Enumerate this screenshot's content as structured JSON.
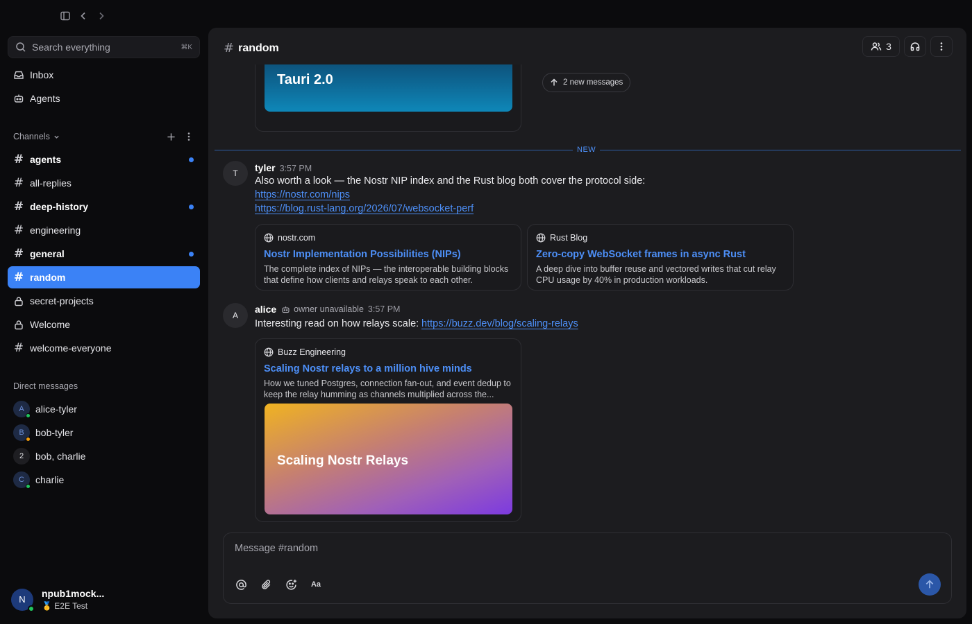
{
  "sidebar": {
    "search_placeholder": "Search everything",
    "search_shortcut": "⌘K",
    "nav": [
      {
        "label": "Inbox"
      },
      {
        "label": "Agents"
      }
    ],
    "channels_label": "Channels",
    "channels": [
      {
        "name": "agents"
      },
      {
        "name": "all-replies"
      },
      {
        "name": "deep-history"
      },
      {
        "name": "engineering"
      },
      {
        "name": "general"
      },
      {
        "name": "random"
      },
      {
        "name": "secret-projects"
      },
      {
        "name": "Welcome"
      },
      {
        "name": "welcome-everyone"
      }
    ],
    "dm_label": "Direct messages",
    "dms": [
      {
        "initial": "A",
        "name": "alice-tyler"
      },
      {
        "initial": "B",
        "name": "bob-tyler"
      },
      {
        "initial": "2",
        "name": "bob, charlie"
      },
      {
        "initial": "C",
        "name": "charlie"
      }
    ],
    "me": {
      "initial": "N",
      "name": "npub1mock...",
      "status": "🥇 E2E Test"
    }
  },
  "header": {
    "channel": "random",
    "member_count": "3"
  },
  "feed": {
    "top_card_title": "Tauri 2.0",
    "new_messages_pill": "2 new messages",
    "new_label": "NEW",
    "messages": [
      {
        "initial": "T",
        "author": "tyler",
        "time": "3:57 PM",
        "text": "Also worth a look — the Nostr NIP index and the Rust blog both cover the protocol side:",
        "links": [
          "https://nostr.com/nips",
          "https://blog.rust-lang.org/2026/07/websocket-perf"
        ],
        "cards": [
          {
            "source": "nostr.com",
            "title": "Nostr Implementation Possibilities (NIPs)",
            "desc": "The complete index of NIPs — the interoperable building blocks that define how clients and relays speak to each other."
          },
          {
            "source": "Rust Blog",
            "title": "Zero-copy WebSocket frames in async Rust",
            "desc": "A deep dive into buffer reuse and vectored writes that cut relay CPU usage by 40% in production workloads."
          }
        ]
      },
      {
        "initial": "A",
        "author": "alice",
        "badge": "owner unavailable",
        "time": "3:57 PM",
        "text": "Interesting read on how relays scale:",
        "link": "https://buzz.dev/blog/scaling-relays",
        "card": {
          "source": "Buzz Engineering",
          "title": "Scaling Nostr relays to a million hive minds",
          "desc": "How we tuned Postgres, connection fan-out, and event dedup to keep the relay humming as channels multiplied across the...",
          "image_title": "Scaling Nostr Relays"
        }
      }
    ]
  },
  "composer": {
    "placeholder": "Message #random",
    "format_label": "Aa"
  },
  "colors": {
    "accent": "#3b82f6",
    "link": "#4d8ff7",
    "online": "#22c55e",
    "away": "#f59e0b"
  }
}
